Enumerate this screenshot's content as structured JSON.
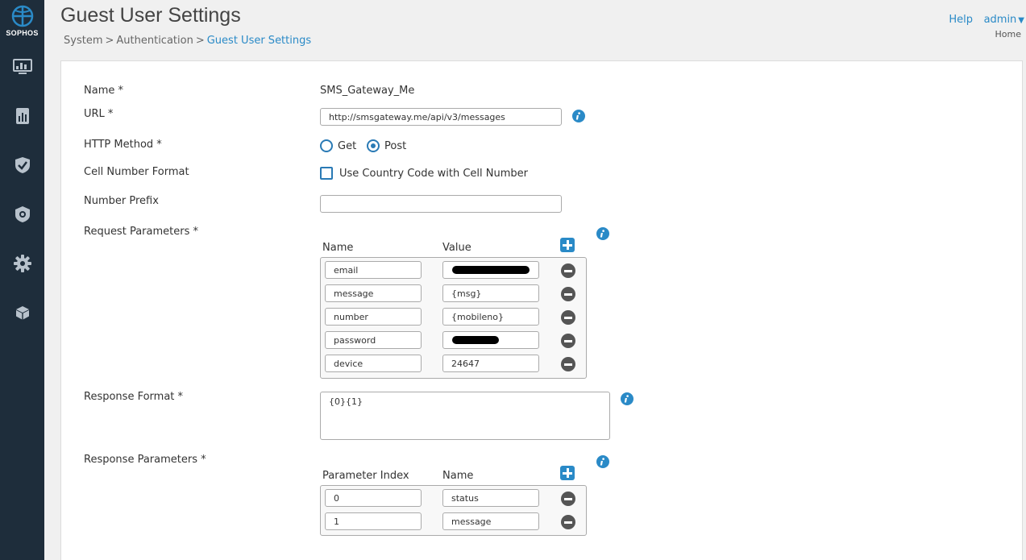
{
  "brand": {
    "logo_text": "SOPHOS"
  },
  "sidebar": {
    "items": [
      {
        "name": "monitor",
        "icon": "monitor-icon"
      },
      {
        "name": "reports",
        "icon": "report-icon"
      },
      {
        "name": "protect",
        "icon": "shield-check-icon"
      },
      {
        "name": "security",
        "icon": "shield-gear-icon"
      },
      {
        "name": "configure",
        "icon": "gear-icon"
      },
      {
        "name": "system",
        "icon": "cube-icon"
      }
    ]
  },
  "header": {
    "title": "Guest User Settings",
    "breadcrumb": [
      "System",
      "Authentication",
      "Guest User Settings"
    ],
    "breadcrumb_sep": ">",
    "help_label": "Help",
    "admin_label": "admin",
    "home_label": "Home"
  },
  "form": {
    "name": {
      "label": "Name *",
      "value": "SMS_Gateway_Me"
    },
    "url": {
      "label": "URL *",
      "value": "http://smsgateway.me/api/v3/messages"
    },
    "http_method": {
      "label": "HTTP Method *",
      "options": [
        "Get",
        "Post"
      ],
      "selected": "Post"
    },
    "cell_number_format": {
      "label": "Cell Number Format",
      "checkbox_label": "Use Country Code with Cell Number",
      "checked": false
    },
    "number_prefix": {
      "label": "Number Prefix",
      "value": ""
    },
    "request_parameters": {
      "label": "Request Parameters *",
      "columns": [
        "Name",
        "Value"
      ],
      "rows": [
        {
          "name": "email",
          "value": "",
          "redacted": true
        },
        {
          "name": "message",
          "value": "{msg}",
          "redacted": false
        },
        {
          "name": "number",
          "value": "{mobileno}",
          "redacted": false
        },
        {
          "name": "password",
          "value": "",
          "redacted": true
        },
        {
          "name": "device",
          "value": "24647",
          "redacted": false
        }
      ]
    },
    "response_format": {
      "label": "Response Format *",
      "value": "{0}{1}"
    },
    "response_parameters": {
      "label": "Response Parameters *",
      "columns": [
        "Parameter Index",
        "Name"
      ],
      "rows": [
        {
          "index": "0",
          "name": "status"
        },
        {
          "index": "1",
          "name": "message"
        }
      ]
    }
  },
  "colors": {
    "sidebar_bg": "#1e2d3b",
    "link": "#2a8ac7",
    "accent": "#2a7ab5"
  }
}
